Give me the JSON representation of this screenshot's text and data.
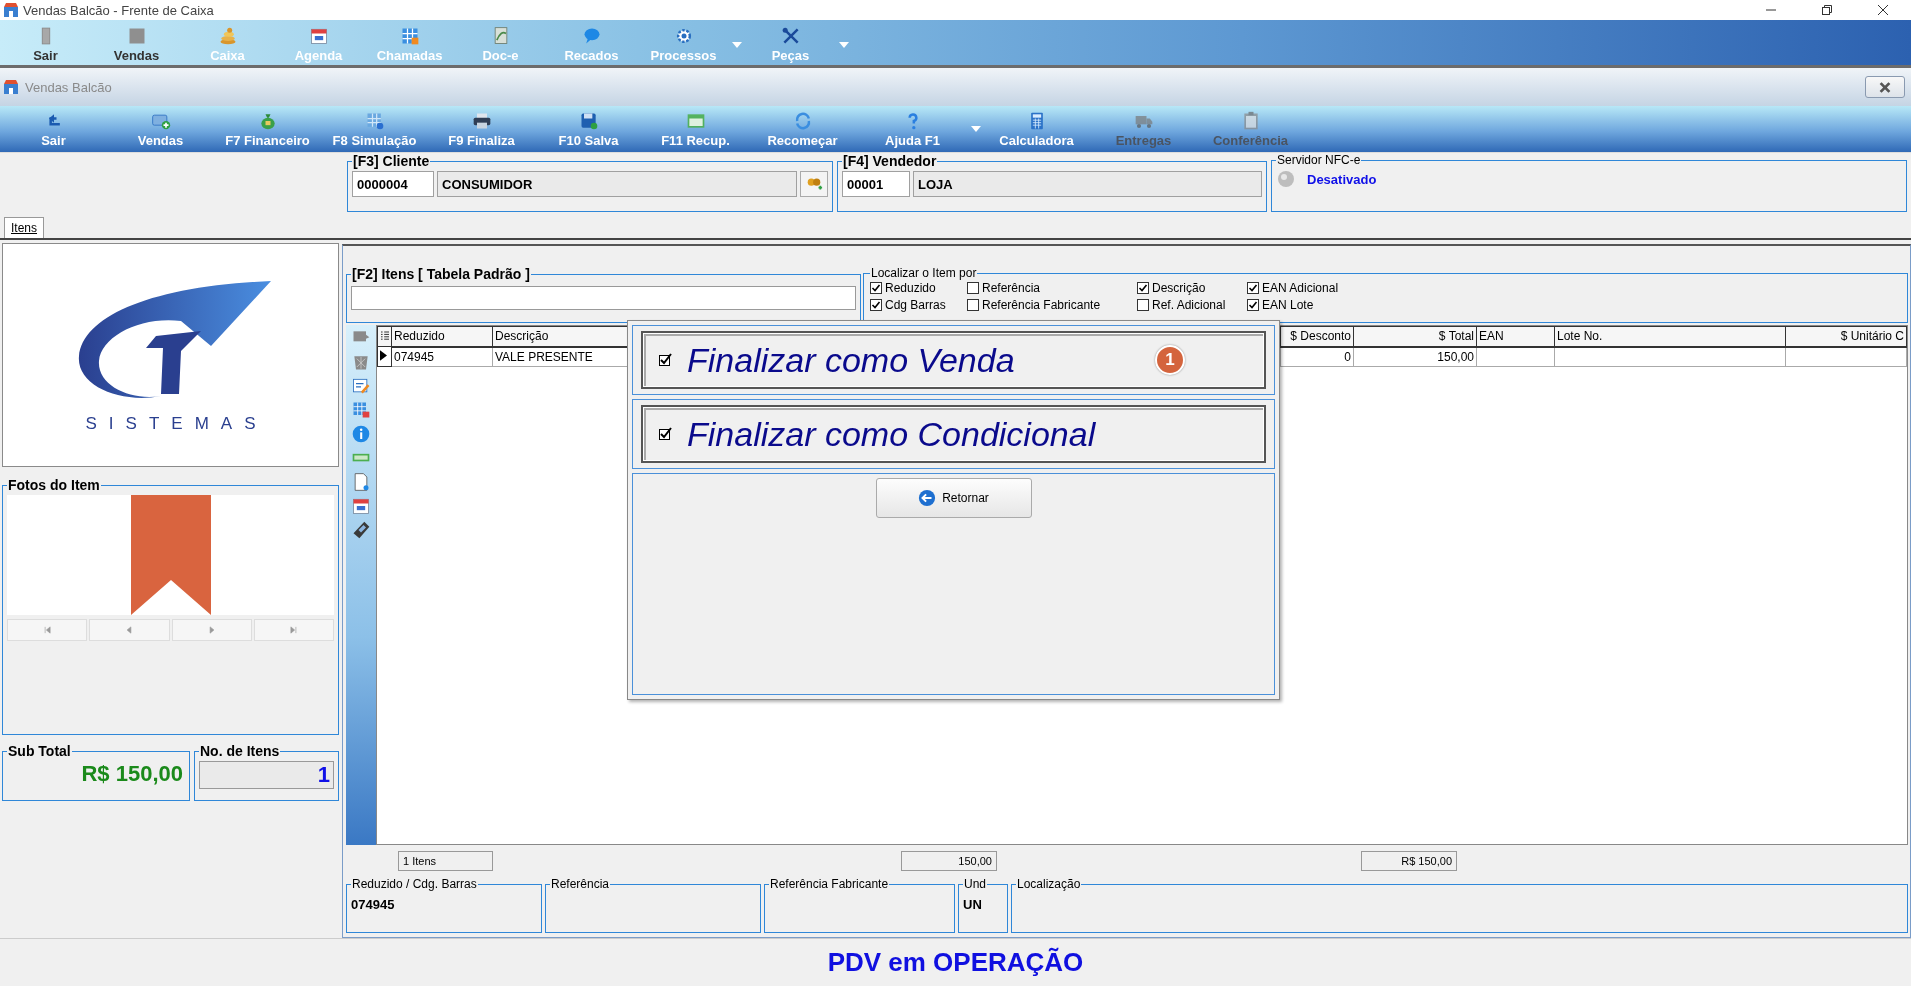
{
  "window": {
    "title": "Vendas Balcão - Frente de Caixa"
  },
  "main_toolbar": [
    {
      "label": "Sair",
      "dropdown": false
    },
    {
      "label": "Vendas",
      "dropdown": false
    },
    {
      "label": "Caixa",
      "dropdown": false
    },
    {
      "label": "Agenda",
      "dropdown": false
    },
    {
      "label": "Chamadas",
      "dropdown": false
    },
    {
      "label": "Doc-e",
      "dropdown": false
    },
    {
      "label": "Recados",
      "dropdown": false
    },
    {
      "label": "Processos",
      "dropdown": true
    },
    {
      "label": "Peças",
      "dropdown": true
    }
  ],
  "child_window": {
    "title": "Vendas Balcão"
  },
  "toolbar": [
    {
      "label": "Sair",
      "disabled": false,
      "dropdown": false
    },
    {
      "label": "Vendas",
      "disabled": false,
      "dropdown": false
    },
    {
      "label": "F7 Financeiro",
      "disabled": false,
      "dropdown": false
    },
    {
      "label": "F8 Simulação",
      "disabled": false,
      "dropdown": false
    },
    {
      "label": "F9 Finaliza",
      "disabled": false,
      "dropdown": false
    },
    {
      "label": "F10 Salva",
      "disabled": false,
      "dropdown": false
    },
    {
      "label": "F11 Recup.",
      "disabled": false,
      "dropdown": false
    },
    {
      "label": "Recomeçar",
      "disabled": false,
      "dropdown": false
    },
    {
      "label": "Ajuda F1",
      "disabled": false,
      "dropdown": true
    },
    {
      "label": "Calculadora",
      "disabled": false,
      "dropdown": false
    },
    {
      "label": "Entregas",
      "disabled": true,
      "dropdown": false
    },
    {
      "label": "Conferência",
      "disabled": true,
      "dropdown": false
    }
  ],
  "cliente": {
    "legend": "[F3] Cliente",
    "code": "0000004",
    "name": "CONSUMIDOR"
  },
  "vendedor": {
    "legend": "[F4] Vendedor",
    "code": "00001",
    "name": "LOJA"
  },
  "nfce": {
    "legend": "Servidor NFC-e",
    "status": "Desativado"
  },
  "tabs": [
    {
      "label": "Itens",
      "selected": true
    }
  ],
  "logo": {
    "text": "SISTEMAS"
  },
  "photos": {
    "legend": "Fotos do Item"
  },
  "subtotal": {
    "legend": "Sub Total",
    "value": "R$ 150,00"
  },
  "item_count": {
    "legend": "No. de Itens",
    "value": "1"
  },
  "search": {
    "legend": "[F2] Itens [ Tabela Padrão ]"
  },
  "locate": {
    "legend": "Localizar o Item por",
    "options": [
      {
        "label": "Reduzido",
        "checked": true
      },
      {
        "label": "Referência",
        "checked": false
      },
      {
        "label": "Descrição",
        "checked": true
      },
      {
        "label": "EAN Adicional",
        "checked": true
      },
      {
        "label": "Cdg Barras",
        "checked": true
      },
      {
        "label": "Referência Fabricante",
        "checked": false
      },
      {
        "label": "Ref. Adicional",
        "checked": false
      },
      {
        "label": "EAN Lote",
        "checked": true
      }
    ]
  },
  "table": {
    "columns": [
      "Reduzido",
      "Descrição",
      "$ Desconto",
      "$ Total",
      "EAN",
      "Lote No.",
      "$ Unitário C"
    ],
    "rows": [
      {
        "selected": true,
        "reduzido": "074945",
        "descricao": "VALE PRESENTE",
        "desconto": "0",
        "total": "150,00"
      }
    ]
  },
  "footer": [
    "1 Itens",
    "150,00",
    "R$ 150,00"
  ],
  "details": [
    {
      "label": "Reduzido / Cdg. Barras",
      "value": "074945"
    },
    {
      "label": "Referência"
    },
    {
      "label": "Referência Fabricante"
    },
    {
      "label": "Und",
      "value": "UN"
    },
    {
      "label": "Localização"
    }
  ],
  "dialog": {
    "options": [
      {
        "label": "Finalizar como Venda",
        "checked": true,
        "badge": "1"
      },
      {
        "label": "Finalizar como Condicional",
        "checked": true
      }
    ],
    "button": "Retornar"
  },
  "status_bar": "PDV em OPERAÇÃO"
}
